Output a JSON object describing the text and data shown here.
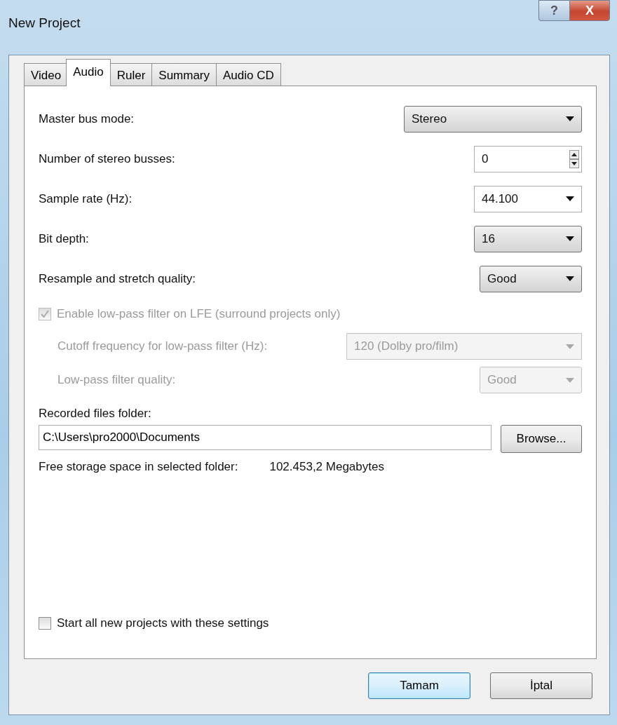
{
  "window": {
    "title": "New Project",
    "help_button": "?",
    "close_button": "X"
  },
  "tabs": [
    {
      "label": "Video",
      "selected": false
    },
    {
      "label": "Audio",
      "selected": true
    },
    {
      "label": "Ruler",
      "selected": false
    },
    {
      "label": "Summary",
      "selected": false
    },
    {
      "label": "Audio CD",
      "selected": false
    }
  ],
  "settings": [
    {
      "label": "Master bus mode:",
      "kind": "dropdown",
      "value": "Stereo",
      "disabled": false
    },
    {
      "label": "Number of stereo busses:",
      "kind": "spinner",
      "value": "0",
      "disabled": false
    },
    {
      "label": "Sample rate (Hz):",
      "kind": "combo",
      "value": "44.100",
      "disabled": false
    },
    {
      "label": "Bit depth:",
      "kind": "dropdown",
      "value": "16",
      "disabled": false
    },
    {
      "label": "Resample and stretch quality:",
      "kind": "dropdown",
      "value": "Good",
      "disabled": false
    }
  ],
  "lfe_filter": {
    "label": "Enable low-pass filter on LFE (surround projects only)",
    "checked": true,
    "disabled": true
  },
  "lfe_settings": [
    {
      "label": "Cutoff frequency for low-pass filter (Hz):",
      "kind": "combo",
      "value": "120 (Dolby pro/film)",
      "disabled": true
    },
    {
      "label": "Low-pass filter quality:",
      "kind": "dropdown",
      "value": "Good",
      "disabled": true
    }
  ],
  "recorded_folder": {
    "label": "Recorded files folder:",
    "value": "C:\\Users\\pro2000\\Documents",
    "browse_button": "Browse..."
  },
  "free_storage": {
    "label": "Free storage space in selected folder:",
    "value": "102.453,2 Megabytes"
  },
  "start_checkbox": {
    "label": "Start all new projects with these settings",
    "checked": false
  },
  "buttons": [
    {
      "label": "Tamam",
      "default": true
    },
    {
      "label": "İptal",
      "default": false
    }
  ]
}
